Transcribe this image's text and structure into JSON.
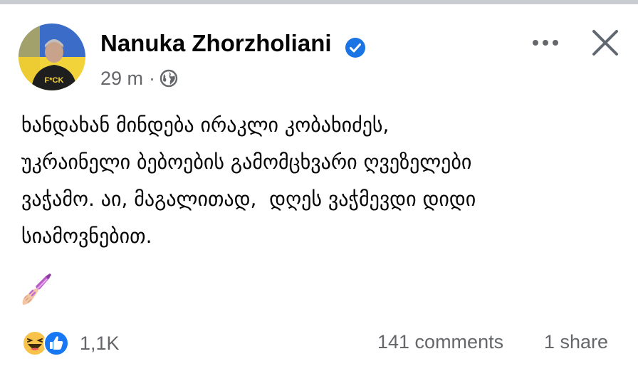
{
  "post": {
    "author": "Nanuka Zhorzholiani",
    "time": "29 m",
    "separator": "·",
    "text": "ხანდახან მინდება ირაკლი კობახიძეს,\nუკრაინელი ბებოების გამომცხვარი ღვეზელები\nვაჭამო. აი, მაგალითად,  დღეს ვაჭმევდი დიდი\nსიამოვნებით.",
    "emoji_icon": "nail-polish-icon",
    "avatar_shirt_text": "F*CK"
  },
  "reactions": {
    "count": "1,1K",
    "icons": [
      "haha-icon",
      "like-icon"
    ]
  },
  "stats": {
    "comments": "141 comments",
    "shares": "1 share"
  },
  "colors": {
    "text": "#050505",
    "secondary": "#65676b",
    "verified_blue": "#1b74e4",
    "like_blue": "#1877f2",
    "haha_yellow": "#f7c34a"
  }
}
